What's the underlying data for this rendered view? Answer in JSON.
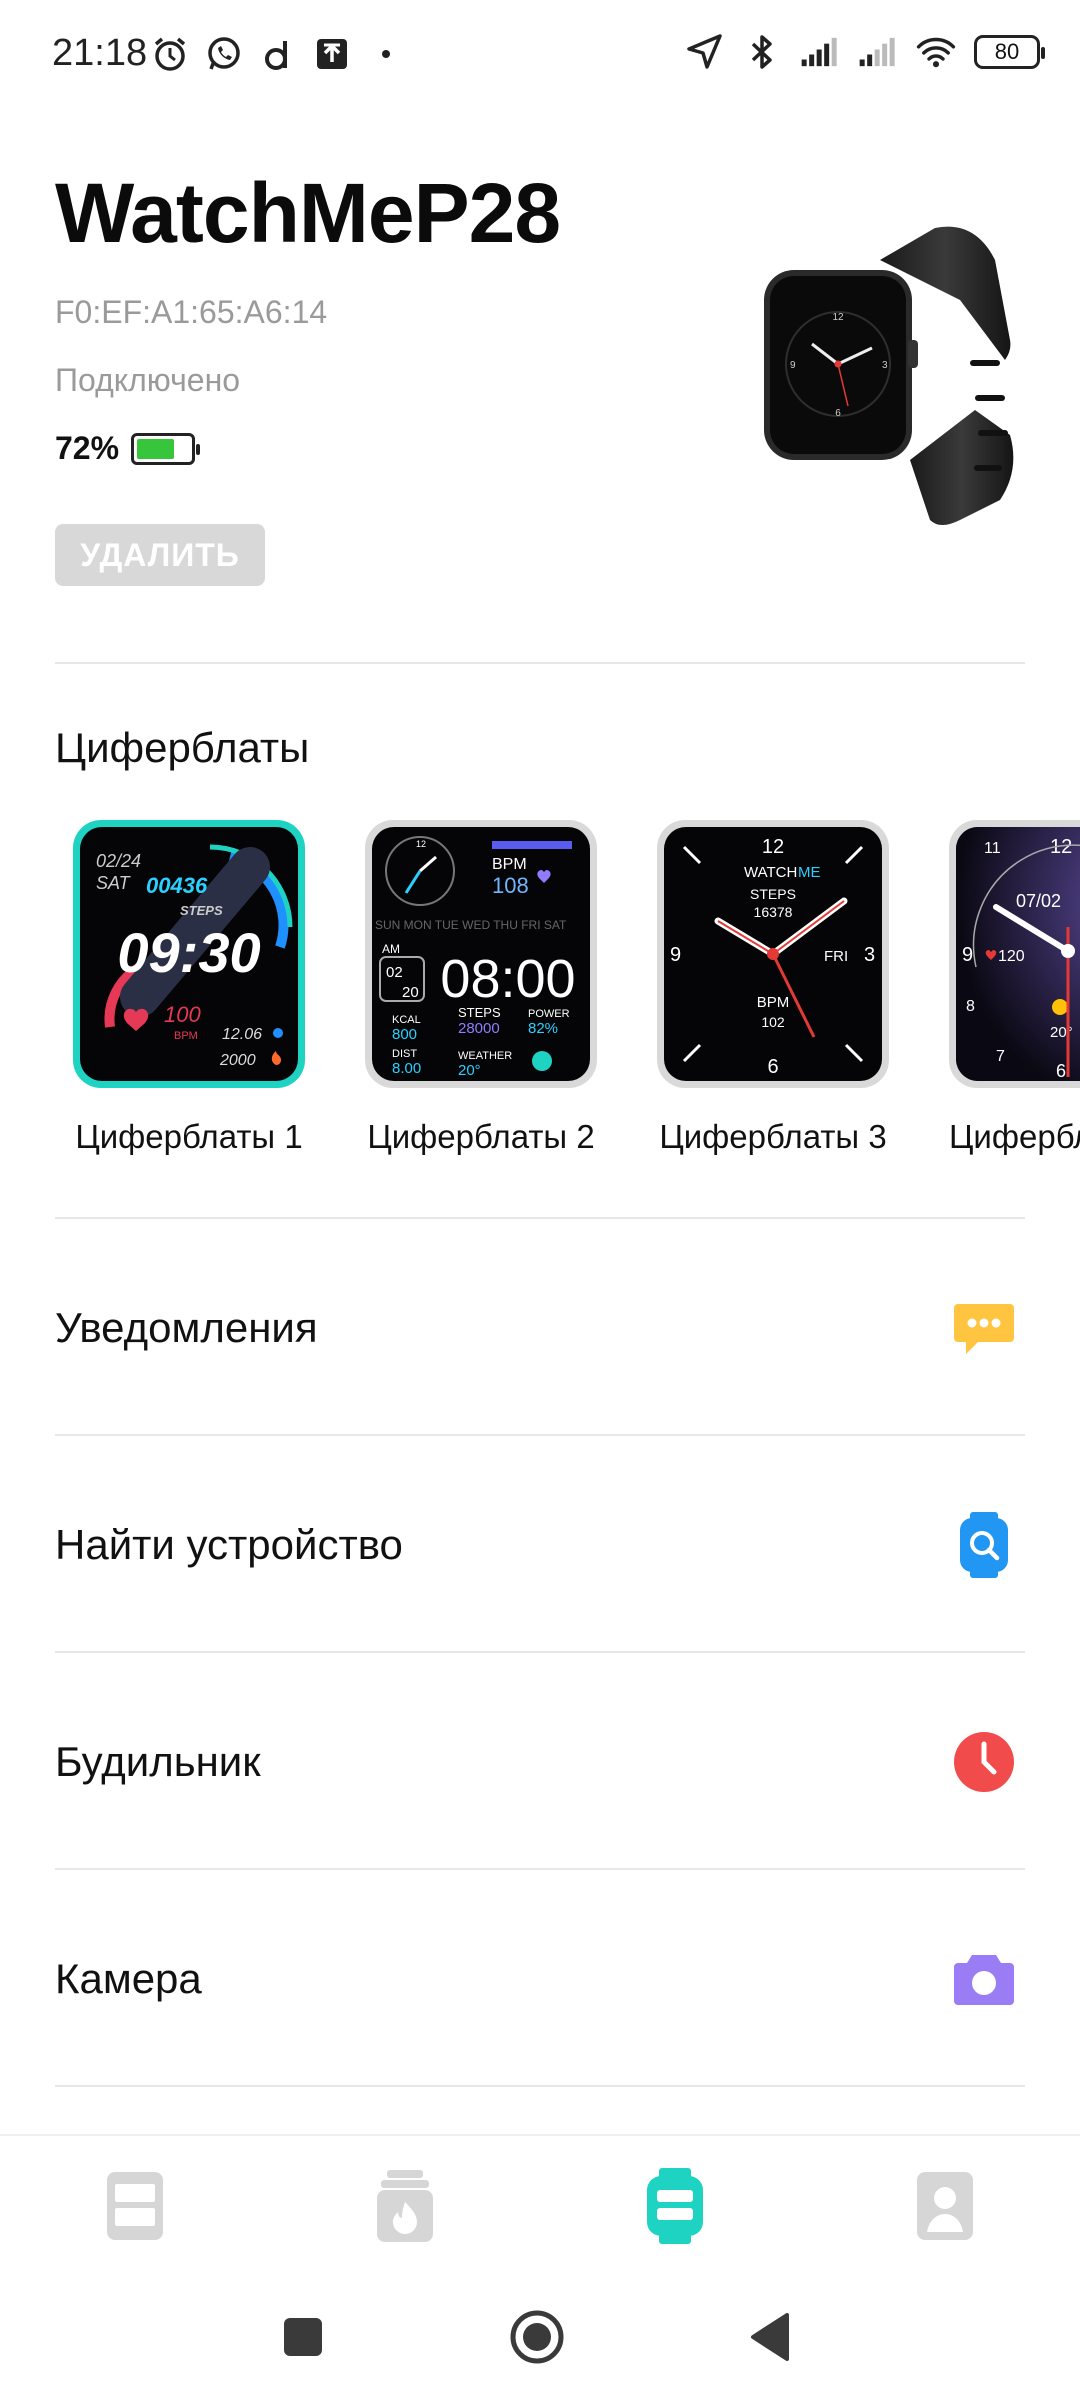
{
  "status_bar": {
    "time": "21:18",
    "battery": "80",
    "left_icons": [
      "alarm-icon",
      "whatsapp-icon",
      "d-app-icon",
      "upload-icon",
      "dot-icon"
    ],
    "right_icons": [
      "location-icon",
      "bluetooth-icon",
      "signal-icon",
      "signal-icon",
      "wifi-icon"
    ]
  },
  "device": {
    "name": "WatchMeP28",
    "mac": "F0:EF:A1:65:A6:14",
    "status": "Подключено",
    "battery_text": "72%",
    "battery_level": 0.72,
    "delete_label": "УДАЛИТЬ"
  },
  "faces": {
    "title": "Циферблаты",
    "items": [
      {
        "label": "Циферблаты 1",
        "selected": true,
        "date": "02/24",
        "day": "SAT",
        "steps": "00436",
        "steps_label": "STEPS",
        "time": "09:30",
        "bpm": "100",
        "bpm_label": "BPM",
        "dist": "12.06",
        "kcal": "2000"
      },
      {
        "label": "Циферблаты 2",
        "selected": false,
        "bpm_label": "BPM",
        "bpm": "108",
        "weekdays": "SUN MON TUE WED THU FRI SAT",
        "ampm": "AM",
        "month": "02",
        "day": "20",
        "time": "08:00",
        "kcal_label": "KCAL",
        "kcal": "800",
        "steps_label": "STEPS",
        "steps": "28000",
        "power_label": "POWER",
        "power": "82%",
        "dist_label": "DIST",
        "dist": "8.00",
        "weather_label": "WEATHER",
        "weather": "20°"
      },
      {
        "label": "Циферблаты 3",
        "selected": false,
        "brand_a": "WATCH",
        "brand_b": "ME",
        "steps_label": "STEPS",
        "steps": "16378",
        "day": "FRI",
        "bpm_label": "BPM",
        "bpm": "102",
        "n12": "12",
        "n3": "3",
        "n6": "6",
        "n9": "9"
      },
      {
        "label": "Циферблаты",
        "selected": false,
        "date": "07/02",
        "hr": "120",
        "temp": "20°",
        "n11": "11",
        "n12": "12",
        "n9": "9",
        "n8": "8",
        "n7": "7",
        "n6": "6"
      }
    ]
  },
  "menu": [
    {
      "label": "Уведомления",
      "icon": "message-icon",
      "color": "#ffc440"
    },
    {
      "label": "Найти устройство",
      "icon": "find-watch-icon",
      "color": "#2196f3"
    },
    {
      "label": "Будильник",
      "icon": "clock-icon",
      "color": "#f24b4b"
    },
    {
      "label": "Камера",
      "icon": "camera-icon",
      "color": "#9a7cf5"
    }
  ],
  "nav": {
    "items": [
      "home-icon",
      "activity-icon",
      "device-icon",
      "profile-icon"
    ],
    "active_index": 2,
    "accent": "#1fd3c2",
    "inactive": "#d6d6d6"
  }
}
